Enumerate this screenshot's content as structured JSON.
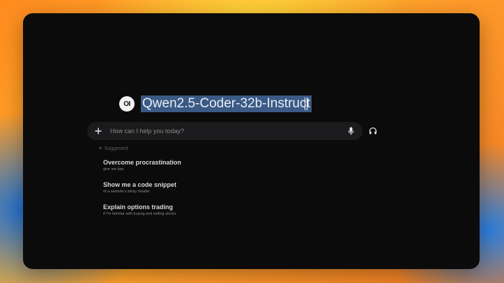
{
  "model": {
    "logo_text": "OI",
    "name": "Qwen2.5-Coder-32b-Instruct"
  },
  "prompt": {
    "placeholder": "How can I help you today?"
  },
  "suggested": {
    "heading": "Suggested",
    "items": [
      {
        "title": "Overcome procrastination",
        "subtitle": "give me tips"
      },
      {
        "title": "Show me a code snippet",
        "subtitle": "of a website's sticky header"
      },
      {
        "title": "Explain options trading",
        "subtitle": "if I'm familiar with buying and selling stocks"
      }
    ]
  },
  "icons": {
    "plus": "plus-icon",
    "mic": "microphone-icon",
    "headset": "headphones-icon",
    "spark": "sparkle-icon"
  },
  "colors": {
    "window_bg": "#0b0b0c",
    "selection": "#3b5a85",
    "input_bg": "#1b1b1d"
  }
}
